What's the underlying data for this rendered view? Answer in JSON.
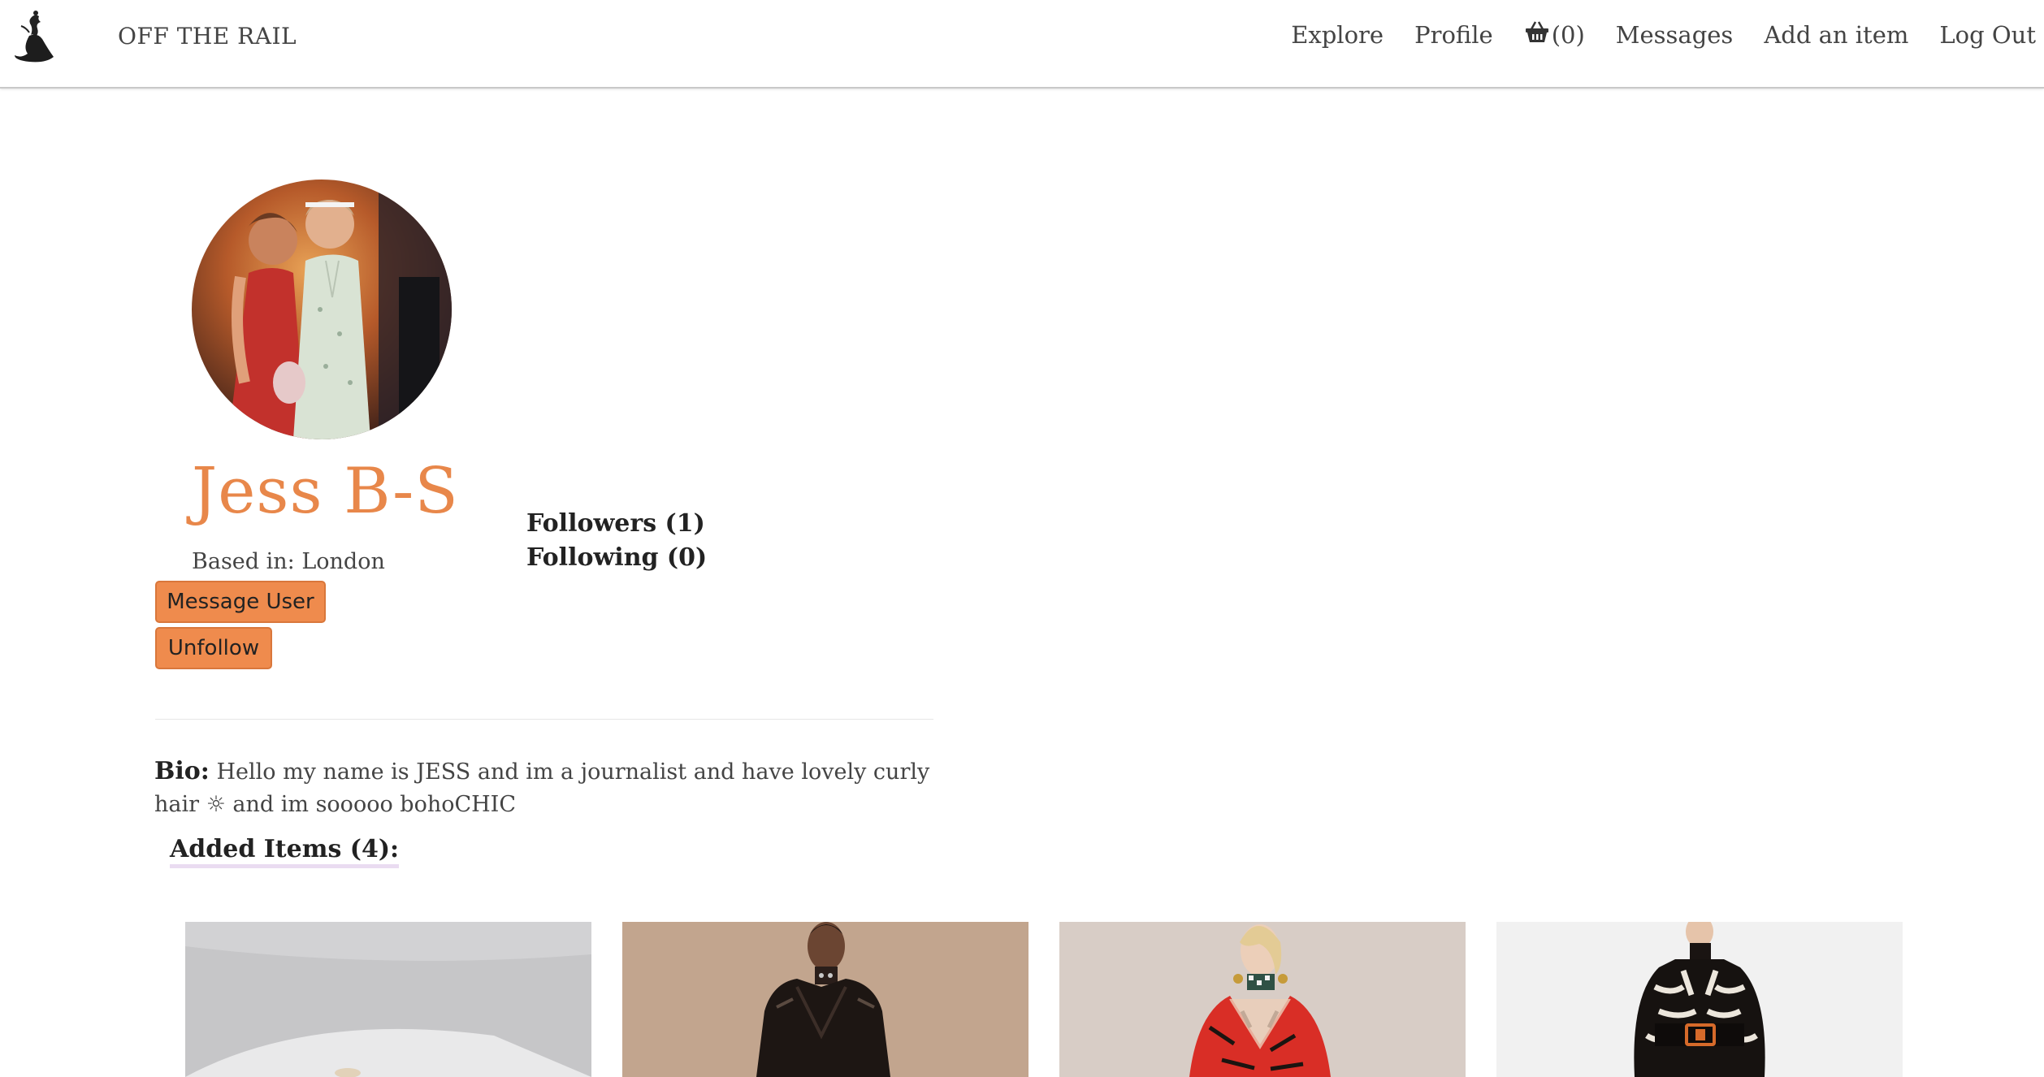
{
  "header": {
    "brand": "OFF THE RAIL",
    "nav": {
      "explore": "Explore",
      "profile": "Profile",
      "cart_count": "(0)",
      "messages": "Messages",
      "add_item": "Add an item",
      "logout": "Log Out"
    }
  },
  "profile": {
    "name": "Jess B-S",
    "based_in": "Based in: London",
    "message_button": "Message User",
    "unfollow_button": "Unfollow",
    "followers": "Followers (1)",
    "following": "Following (0)",
    "bio_label": "Bio:",
    "bio_text": "Hello my name is JESS and im a journalist and have lovely curly hair ☼ and im sooooo bohoCHIC",
    "added_items": "Added Items (4):"
  },
  "items": [
    {
      "icon": "item-photo-light-garment"
    },
    {
      "icon": "item-photo-leather-jacket"
    },
    {
      "icon": "item-photo-red-tiger-dress"
    },
    {
      "icon": "item-photo-skeleton-print-knit"
    }
  ],
  "colors": {
    "accent": "#ef8b4d",
    "name_color": "#e8874a",
    "highlight": "#eadcf1"
  }
}
